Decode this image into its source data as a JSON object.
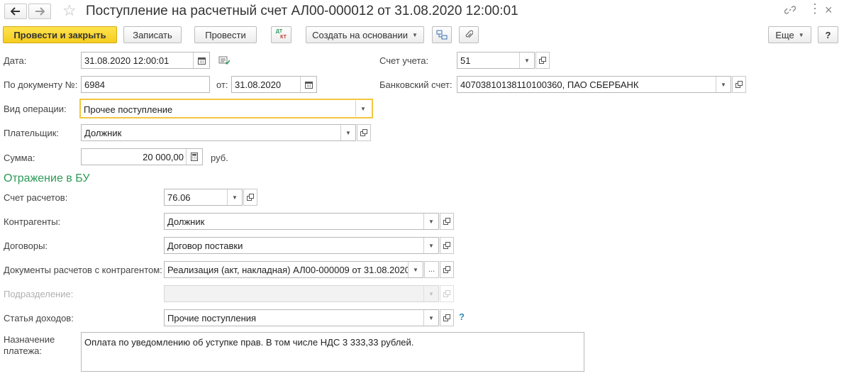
{
  "window": {
    "title": "Поступление на расчетный счет АЛ00-000012 от 31.08.2020 12:00:01"
  },
  "toolbar": {
    "post_close": "Провести и закрыть",
    "write": "Записать",
    "post": "Провести",
    "dtkt_top": "ДТ",
    "dtkt_bottom": "КТ",
    "create_based": "Создать на основании",
    "more": "Еще",
    "help": "?"
  },
  "form": {
    "date_label": "Дата:",
    "date_value": "31.08.2020 12:00:01",
    "account_label": "Счет учета:",
    "account_value": "51",
    "doc_num_label": "По документу №:",
    "doc_num_value": "6984",
    "from_label": "от:",
    "from_value": "31.08.2020",
    "bank_label": "Банковский счет:",
    "bank_value": "40703810138110100360, ПАО СБЕРБАНК",
    "op_type_label": "Вид операции:",
    "op_type_value": "Прочее поступление",
    "payer_label": "Плательщик:",
    "payer_value": "Должник",
    "sum_label": "Сумма:",
    "sum_value": "20 000,00",
    "sum_currency": "руб."
  },
  "bu": {
    "section_title": "Отражение в БУ",
    "calc_account_label": "Счет расчетов:",
    "calc_account_value": "76.06",
    "contractors_label": "Контрагенты:",
    "contractors_value": "Должник",
    "contracts_label": "Договоры:",
    "contracts_value": "Договор поставки",
    "settle_docs_label": "Документы расчетов с контрагентом:",
    "settle_docs_value": "Реализация (акт, накладная) АЛ00-000009 от 31.08.2020",
    "settle_docs_ellipsis": "...",
    "division_label": "Подразделение:",
    "division_value": "",
    "income_item_label": "Статья доходов:",
    "income_item_value": "Прочие поступления",
    "income_help": "?",
    "purpose_label_1": "Назначение",
    "purpose_label_2": "платежа:",
    "purpose_value": "Оплата по уведомлению об уступке прав. В том числе НДС 3 333,33 рублей."
  },
  "colors": {
    "accent_yellow": "#f5cc1f",
    "section_green": "#2b9a56",
    "focus_border": "#f3c640"
  }
}
